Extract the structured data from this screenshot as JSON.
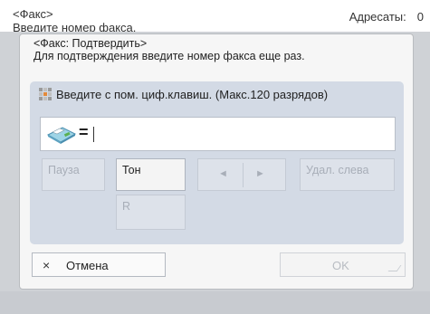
{
  "header": {
    "title": "<Факс>",
    "subtitle": "Введите номер факса.",
    "recipients_label": "Адресаты:",
    "recipients_count": "0"
  },
  "dialog": {
    "title": "<Факс: Подтвердить>",
    "instruction": "Для подтверждения введите номер факса еще раз.",
    "hint": "Введите с пом. циф.клавиш. (Макс.120 разрядов)",
    "input": {
      "prefix": "=",
      "value": ""
    }
  },
  "keys": {
    "pause": "Пауза",
    "tone": "Тон",
    "left_arrow": "◄",
    "right_arrow": "►",
    "delete_left": "Удал. слева",
    "r": "R"
  },
  "buttons": {
    "cancel_icon": "×",
    "cancel": "Отмена",
    "ok": "OK"
  },
  "icons": {
    "hint": "keypad-icon",
    "input": "fax-icon"
  }
}
